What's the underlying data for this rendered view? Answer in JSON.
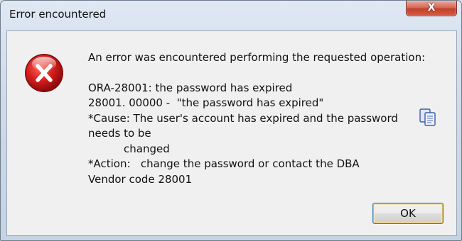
{
  "window": {
    "title": "Error encountered"
  },
  "titlebar": {
    "close_glyph": "X"
  },
  "icons": {
    "error": "error-icon",
    "copy": "copy-icon"
  },
  "message": {
    "summary": "An error was encountered performing the requested operation:",
    "line1": "ORA-28001: the password has expired",
    "line2": "28001. 00000 -  \"the password has expired\"",
    "cause_line": "*Cause:    The user's account has expired and the password needs to be",
    "cause_cont": "changed",
    "action_line": "*Action:   change the password or contact the DBA",
    "vendor_line": "Vendor code 28001"
  },
  "buttons": {
    "ok_label": "OK"
  },
  "colors": {
    "error_red": "#c8141a",
    "close_red": "#c8432c",
    "ok_focus_border": "#3c7fb1"
  }
}
